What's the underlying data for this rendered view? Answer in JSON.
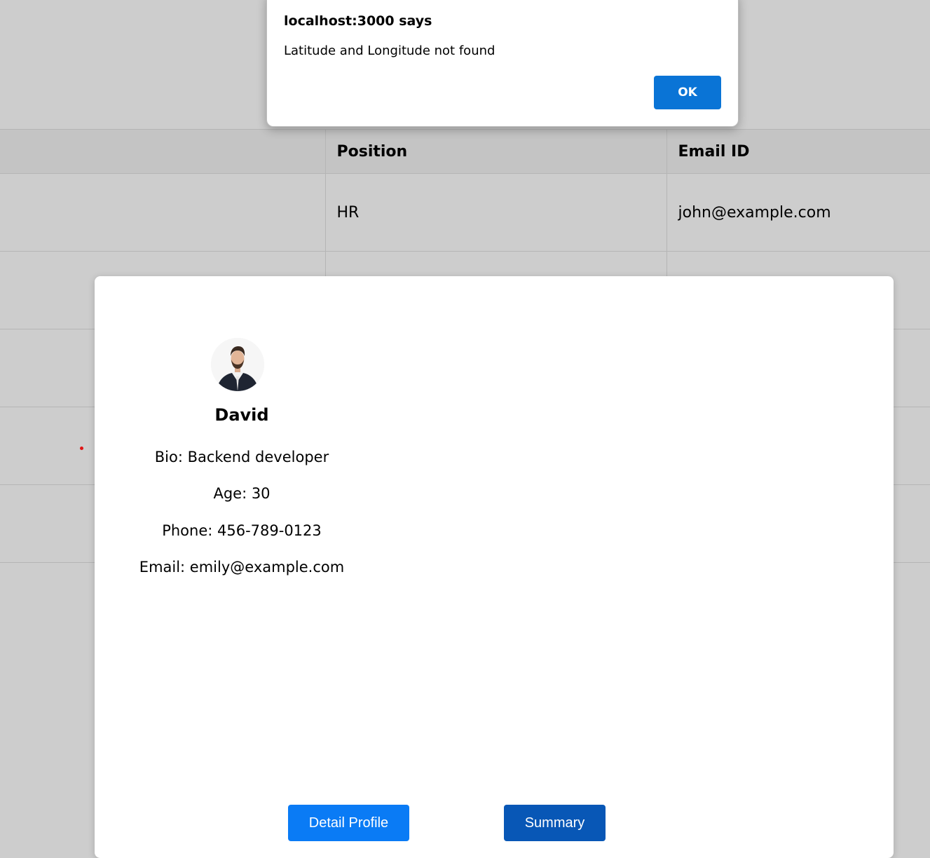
{
  "table": {
    "headers": [
      "",
      "Position",
      "Email ID"
    ],
    "rows": [
      [
        "",
        "HR",
        "john@example.com"
      ],
      [
        "",
        "",
        ""
      ],
      [
        "",
        "",
        ""
      ],
      [
        "",
        "",
        ""
      ],
      [
        "",
        "",
        ""
      ]
    ]
  },
  "profile": {
    "name": "David",
    "bio": "Bio: Backend developer",
    "age": "Age: 30",
    "phone": "Phone: 456-789-0123",
    "email": "Email: emily@example.com",
    "detail_button": "Detail Profile",
    "summary_button": "Summary"
  },
  "alert": {
    "title": "localhost:3000 says",
    "message": "Latitude and Longitude not found",
    "ok_label": "OK"
  },
  "colors": {
    "primary_button": "#0a7bf5",
    "secondary_button": "#0857b6",
    "alert_button": "#0a74d6",
    "overlay": "#cdcdcd"
  }
}
